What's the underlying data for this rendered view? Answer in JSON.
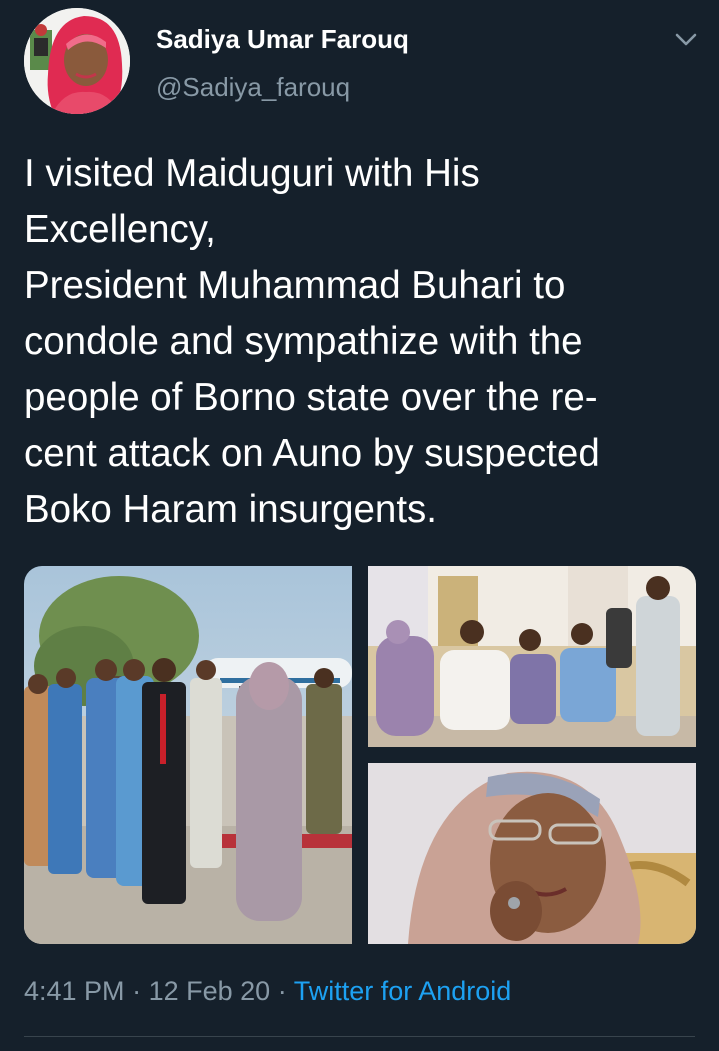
{
  "user": {
    "display_name": "Sadiya Umar Farouq",
    "handle": "@Sadiya_farouq"
  },
  "tweet": {
    "lines": [
      "I visited Maiduguri with His",
      "Excellency,",
      "President Muhammad Buhari to",
      "condole and sympathize with the",
      "people of Borno state over the re-",
      "cent attack on Auno by suspected",
      "Boko Haram insurgents."
    ],
    "time": "4:41 PM",
    "date": "12 Feb 20",
    "separator": "·",
    "source": "Twitter for Android"
  },
  "icons": {
    "menu": "chevron-down-icon"
  },
  "colors": {
    "background": "#15202b",
    "text": "#ffffff",
    "muted": "#8899a6",
    "link": "#1da1f2",
    "divider": "#38444d"
  }
}
